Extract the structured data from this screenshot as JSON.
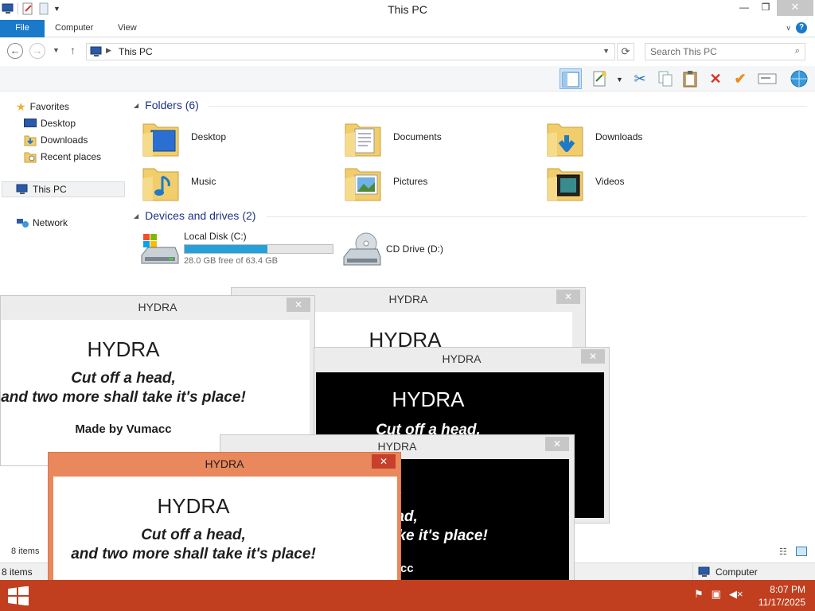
{
  "window": {
    "title": "This PC",
    "minimize_glyph": "—",
    "maximize_glyph": "❐",
    "close_glyph": "✕"
  },
  "ribbon": {
    "tabs": [
      "File",
      "Computer",
      "View"
    ],
    "accent": "#1979ca"
  },
  "address": {
    "path": "This PC",
    "search_placeholder": "Search This PC"
  },
  "toolbar": {
    "icons": [
      "details-pane-icon",
      "properties-icon",
      "cut-icon",
      "copy-icon",
      "paste-icon",
      "delete-icon",
      "checkmark-icon",
      "rename-icon",
      "globe-icon"
    ]
  },
  "navpane": {
    "items": [
      {
        "label": "Favorites",
        "icon": "star-icon"
      },
      {
        "label": "Desktop",
        "icon": "desktop-icon"
      },
      {
        "label": "Downloads",
        "icon": "downloads-icon"
      },
      {
        "label": "Recent places",
        "icon": "recent-places-icon"
      },
      {
        "label": "This PC",
        "icon": "computer-icon"
      },
      {
        "label": "Network",
        "icon": "network-icon"
      }
    ]
  },
  "content": {
    "folders_header": "Folders (6)",
    "folders": [
      {
        "label": "Desktop",
        "icon": "desktop-folder-icon"
      },
      {
        "label": "Documents",
        "icon": "documents-folder-icon"
      },
      {
        "label": "Downloads",
        "icon": "downloads-folder-icon"
      },
      {
        "label": "Music",
        "icon": "music-folder-icon"
      },
      {
        "label": "Pictures",
        "icon": "pictures-folder-icon"
      },
      {
        "label": "Videos",
        "icon": "videos-folder-icon"
      }
    ],
    "devices_header": "Devices and drives (2)",
    "drives": [
      {
        "label": "Local Disk (C:)",
        "free_text": "28.0 GB free of 63.4 GB",
        "used_fraction": 0.56
      },
      {
        "label": "CD Drive (D:)"
      }
    ]
  },
  "status": {
    "items": "8 items",
    "outer_items": "8 items",
    "zone": "Computer"
  },
  "popups": {
    "title": "HYDRA",
    "heading": "HYDRA",
    "line1": "Cut off a head,",
    "line2": "and two more shall take it's place!",
    "credit": "Made by Vumacc",
    "close_glyph": "✕"
  },
  "taskbar": {
    "color": "#c13f1f",
    "time": "8:07 PM",
    "date": "11/17/2025"
  }
}
